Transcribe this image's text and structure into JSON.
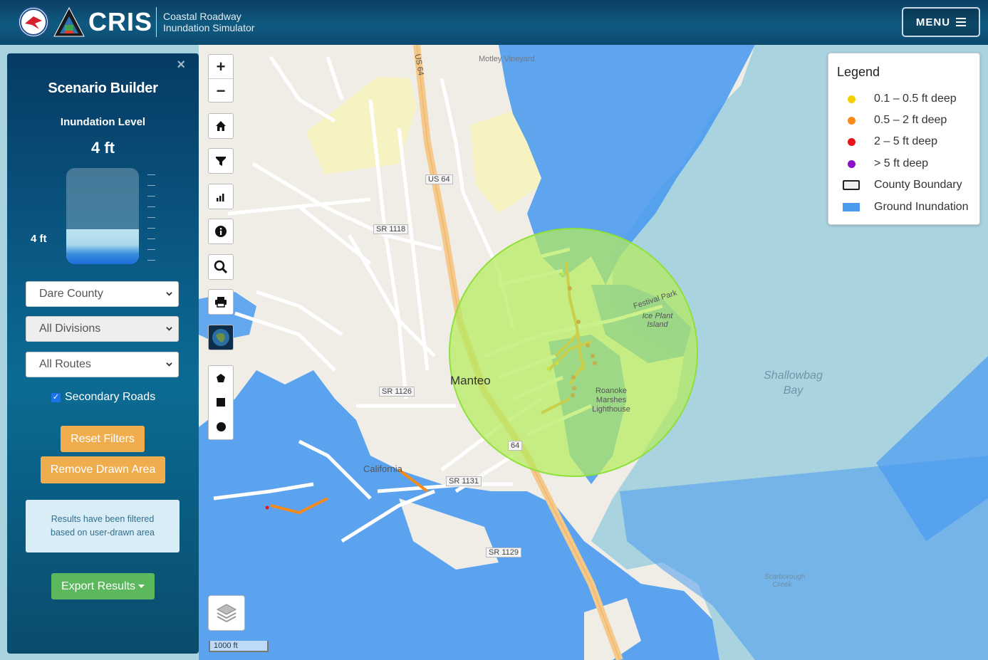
{
  "header": {
    "app_name": "CRIS",
    "subtitle_line1": "Coastal Roadway",
    "subtitle_line2": "Inundation Simulator",
    "menu_label": "MENU"
  },
  "panel": {
    "close_symbol": "×",
    "title": "Scenario Builder",
    "inundation_label": "Inundation Level",
    "inundation_value": "4 ft",
    "gauge_level_label": "4 ft",
    "gauge_fill_fraction": 0.36,
    "county_select": "Dare County",
    "division_select": "All Divisions",
    "route_select": "All Routes",
    "secondary_roads_label": "Secondary Roads",
    "secondary_roads_checked": true,
    "reset_button": "Reset Filters",
    "remove_area_button": "Remove Drawn Area",
    "results_note": "Results have been filtered based on user-drawn area",
    "export_button": "Export Results"
  },
  "map_controls": {
    "zoom_in": "+",
    "zoom_out": "−",
    "tools": [
      "home-icon",
      "filter-icon",
      "bar-chart-icon",
      "info-icon",
      "search-icon",
      "print-icon",
      "basemap-thumbnail"
    ],
    "draw_tools": [
      "polygon-icon",
      "rectangle-icon",
      "circle-icon"
    ],
    "scale_label": "1000 ft"
  },
  "map_labels": {
    "town": "Manteo",
    "bay": "Shallowbag Bay",
    "california": "California",
    "festival_park": "Festival Park",
    "ice_plant": "Ice Plant Island",
    "lighthouse": "Roanoke Marshes Lighthouse",
    "motley": "Motley Vineyard",
    "us64_shield": "US 64",
    "route_64": "64",
    "sr1118": "SR 1118",
    "sr1126": "SR 1126",
    "sr1131": "SR 1131",
    "sr1129": "SR 1129",
    "us64_road": "US 64",
    "scarborough": "Scarborough Creek"
  },
  "legend": {
    "title": "Legend",
    "items": [
      {
        "label": "0.1 – 0.5 ft deep",
        "color": "#f5d000",
        "kind": "dot"
      },
      {
        "label": "0.5 – 2 ft deep",
        "color": "#f78a1c",
        "kind": "dot"
      },
      {
        "label": "2 – 5 ft deep",
        "color": "#e8141c",
        "kind": "dot"
      },
      {
        "label": "> 5 ft deep",
        "color": "#8a12c9",
        "kind": "dot"
      },
      {
        "label": "County Boundary",
        "color": "#222222",
        "kind": "box"
      },
      {
        "label": "Ground Inundation",
        "color": "#4a9af0",
        "kind": "fill"
      }
    ]
  },
  "colors": {
    "water": "#a9d3df",
    "land": "#f0ede7",
    "inundation": "#4a9af0",
    "selection": "#b5ec5e",
    "accent_orange": "#f0ad4e",
    "accent_green": "#5cb85c"
  }
}
